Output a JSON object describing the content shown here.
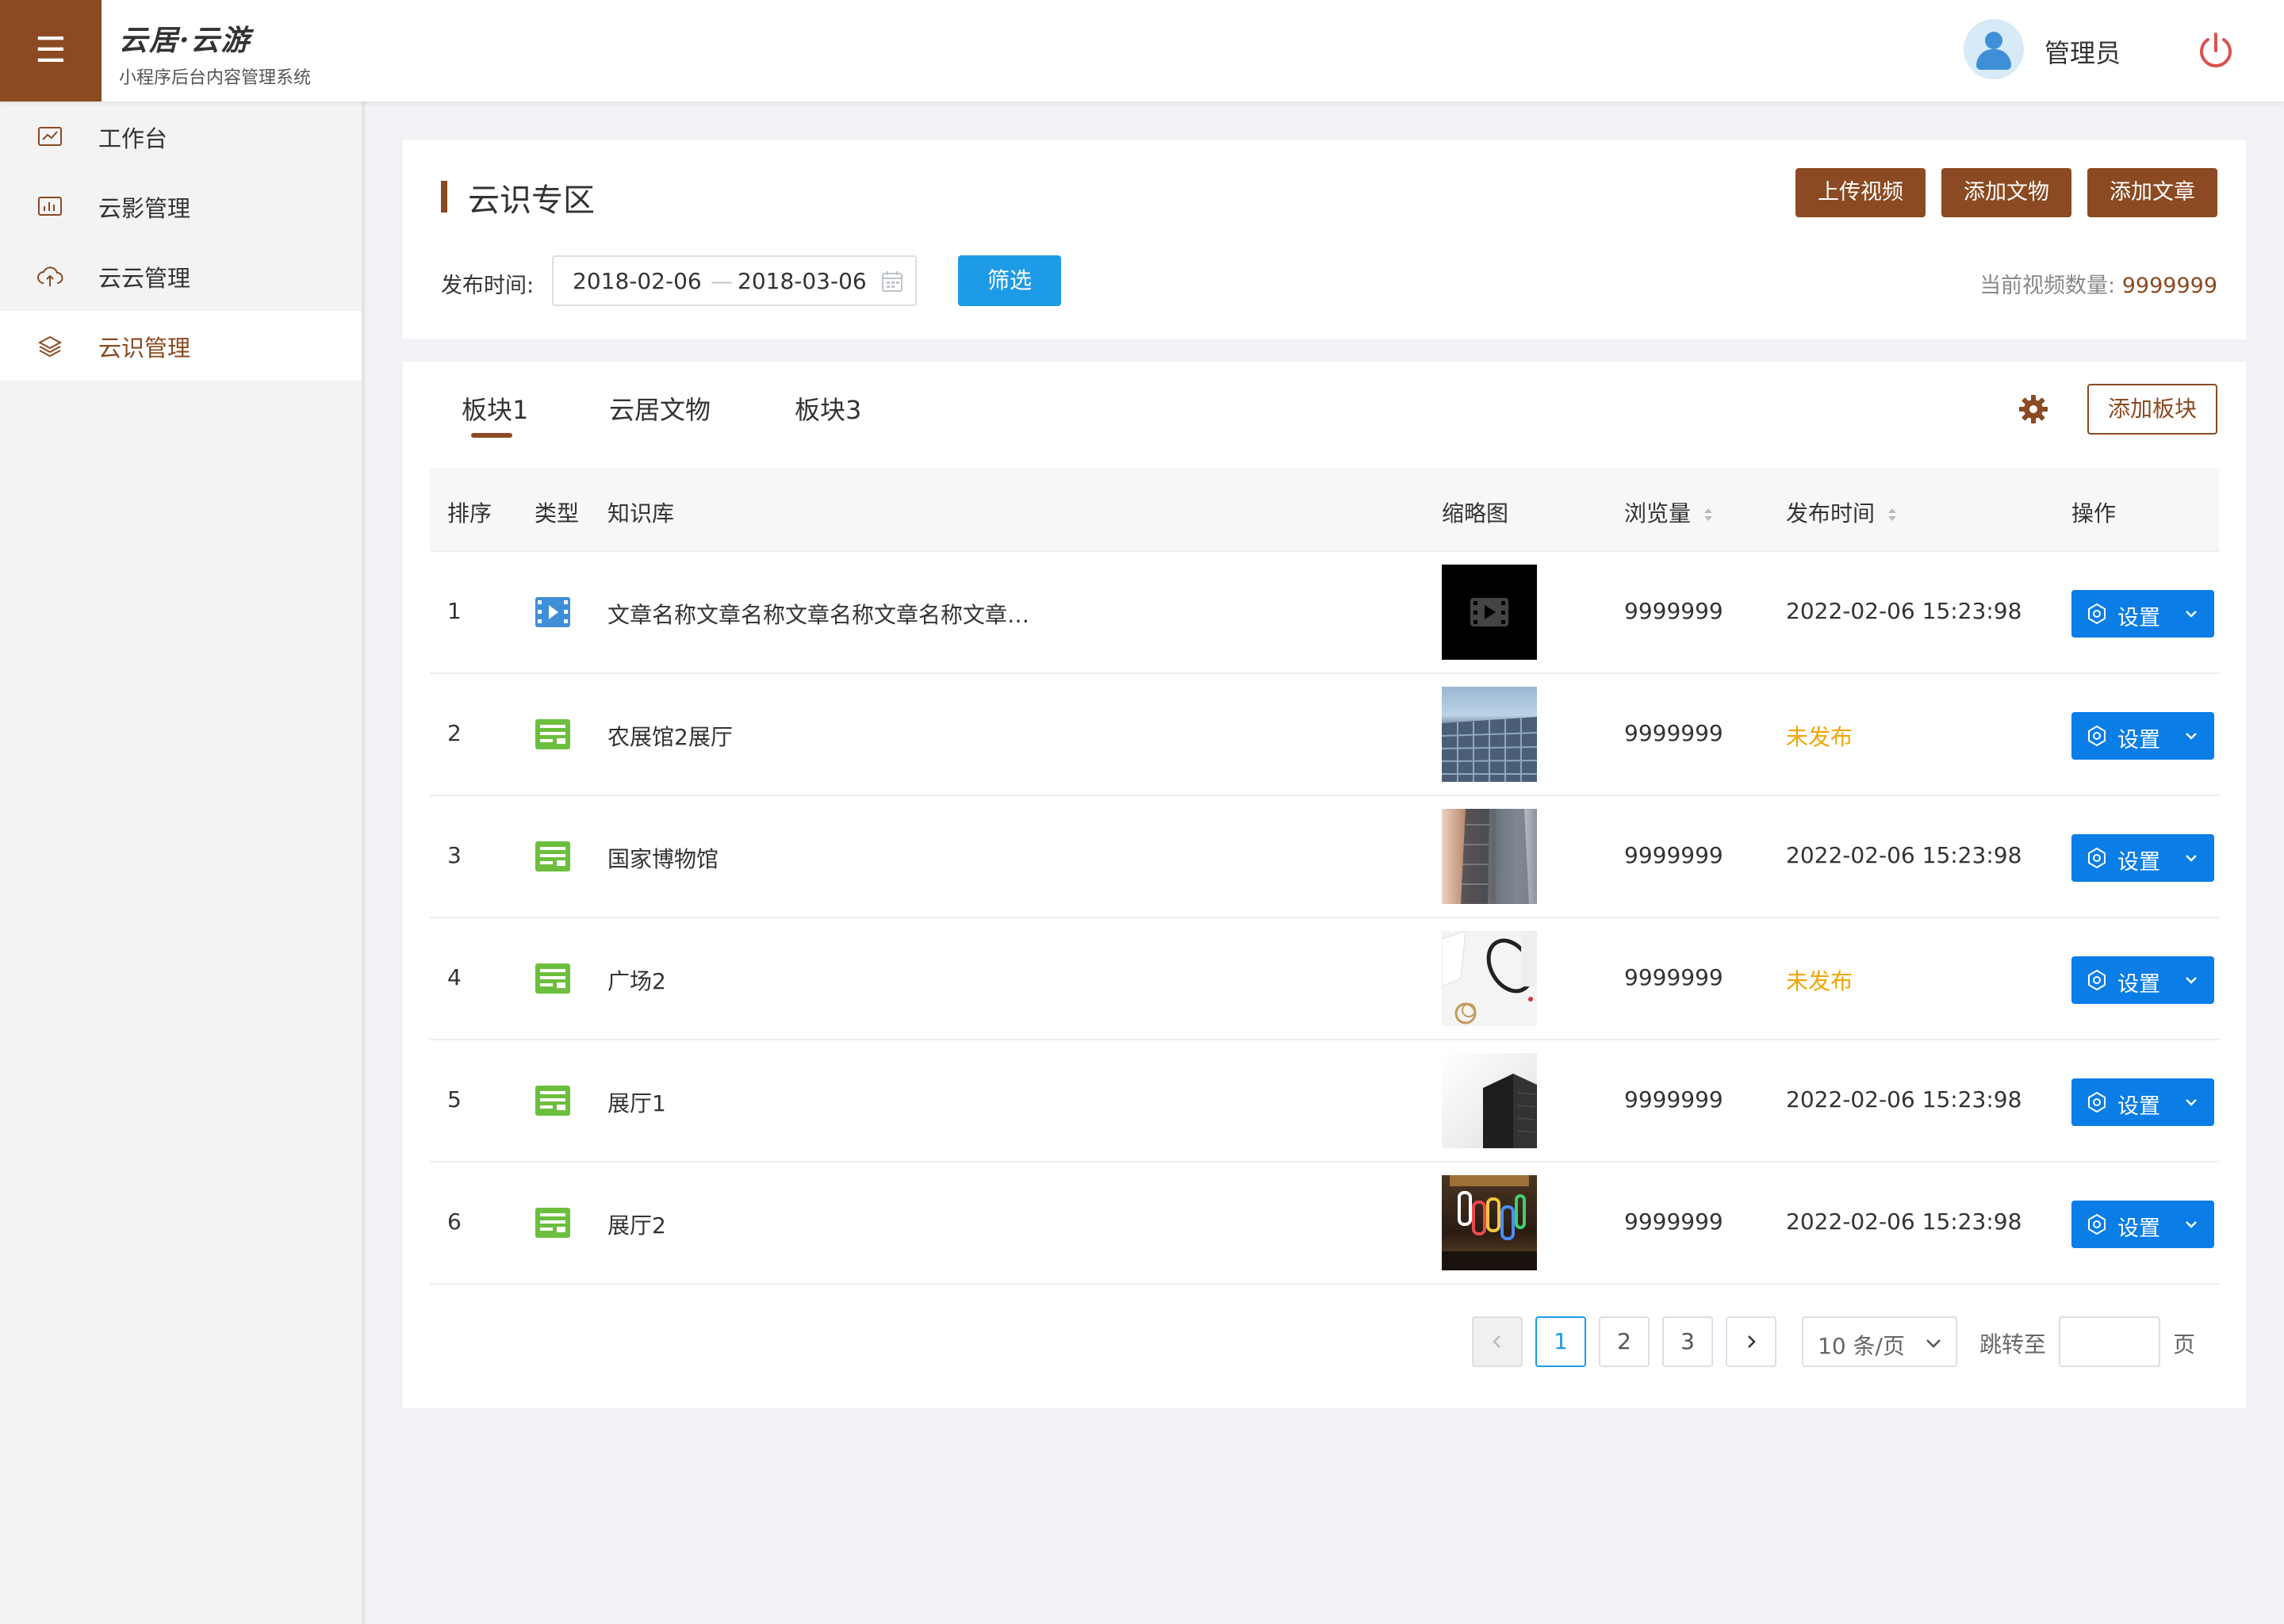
{
  "header": {
    "menu_icon": "☰",
    "brand_title": "云居·云游",
    "brand_subtitle": "小程序后台内容管理系统",
    "user_name": "管理员",
    "accent_color": "#8b4a21"
  },
  "sidebar": {
    "items": [
      {
        "label": "工作台",
        "icon": "chart-line-icon"
      },
      {
        "label": "云影管理",
        "icon": "chart-bar-icon"
      },
      {
        "label": "云云管理",
        "icon": "cloud-upload-icon"
      },
      {
        "label": "云识管理",
        "icon": "layers-icon",
        "active": true
      }
    ]
  },
  "filter": {
    "section_title": "云识专区",
    "buttons": [
      "上传视频",
      "添加文物",
      "添加文章"
    ],
    "date_label": "发布时间:",
    "date_start": "2018-02-06",
    "date_sep": "—",
    "date_end": "2018-03-06",
    "filter_button": "筛选",
    "count_label": "当前视频数量: ",
    "count_value": "9999999"
  },
  "tabs": [
    "板块1",
    "云居文物",
    "板块3"
  ],
  "active_tab": 0,
  "add_block_button": "添加板块",
  "table": {
    "headers": {
      "order": "排序",
      "type": "类型",
      "library": "知识库",
      "thumbnail": "缩略图",
      "views": "浏览量",
      "publish_time": "发布时间",
      "actions": "操作"
    },
    "rows": [
      {
        "order": "1",
        "type": "video",
        "name": "文章名称文章名称文章名称文章名称文章…",
        "views": "9999999",
        "publish": "2022-02-06  15:23:98",
        "published": true,
        "thumb": "video"
      },
      {
        "order": "2",
        "type": "article",
        "name": "农展馆2展厅",
        "views": "9999999",
        "publish": "未发布",
        "published": false,
        "thumb": "building"
      },
      {
        "order": "3",
        "type": "article",
        "name": "国家博物馆",
        "views": "9999999",
        "publish": "2022-02-06  15:23:98",
        "published": true,
        "thumb": "towers"
      },
      {
        "order": "4",
        "type": "article",
        "name": "广场2",
        "views": "9999999",
        "publish": "未发布",
        "published": false,
        "thumb": "desk"
      },
      {
        "order": "5",
        "type": "article",
        "name": "展厅1",
        "views": "9999999",
        "publish": "2022-02-06  15:23:98",
        "published": true,
        "thumb": "tower"
      },
      {
        "order": "6",
        "type": "article",
        "name": "展厅2",
        "views": "9999999",
        "publish": "2022-02-06  15:23:98",
        "published": true,
        "thumb": "sign"
      }
    ],
    "action_label": "设置"
  },
  "pagination": {
    "pages": [
      "1",
      "2",
      "3"
    ],
    "current": "1",
    "page_size": "10 条/页",
    "jump_label": "跳转至",
    "page_suffix": "页"
  }
}
